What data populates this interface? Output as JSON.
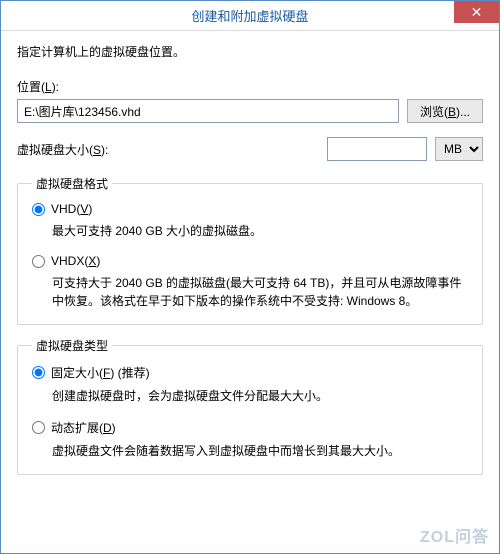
{
  "title": "创建和附加虚拟硬盘",
  "close_glyph": "✕",
  "instruction": "指定计算机上的虚拟硬盘位置。",
  "location": {
    "label_prefix": "位置(",
    "label_key": "L",
    "label_suffix": "):",
    "value": "E:\\图片库\\123456.vhd",
    "browse_prefix": "浏览(",
    "browse_key": "B",
    "browse_suffix": ")..."
  },
  "size": {
    "label_prefix": "虚拟硬盘大小(",
    "label_key": "S",
    "label_suffix": "):",
    "value": "",
    "unit": "MB"
  },
  "format_group": {
    "legend": "虚拟硬盘格式",
    "vhd": {
      "label_prefix": "VHD(",
      "label_key": "V",
      "label_suffix": ")",
      "desc": "最大可支持 2040 GB 大小的虚拟磁盘。",
      "checked": true
    },
    "vhdx": {
      "label_prefix": "VHDX(",
      "label_key": "X",
      "label_suffix": ")",
      "desc": "可支持大于 2040 GB 的虚拟磁盘(最大可支持 64 TB)，并且可从电源故障事件中恢复。该格式在早于如下版本的操作系统中不受支持: Windows 8。",
      "checked": false
    }
  },
  "type_group": {
    "legend": "虚拟硬盘类型",
    "fixed": {
      "label_prefix": "固定大小(",
      "label_key": "F",
      "label_suffix": ") (推荐)",
      "desc": "创建虚拟硬盘时，会为虚拟硬盘文件分配最大大小。",
      "checked": true
    },
    "dynamic": {
      "label_prefix": "动态扩展(",
      "label_key": "D",
      "label_suffix": ")",
      "desc": "虚拟硬盘文件会随着数据写入到虚拟硬盘中而增长到其最大大小。",
      "checked": false
    }
  },
  "watermark": "ZOL问答"
}
